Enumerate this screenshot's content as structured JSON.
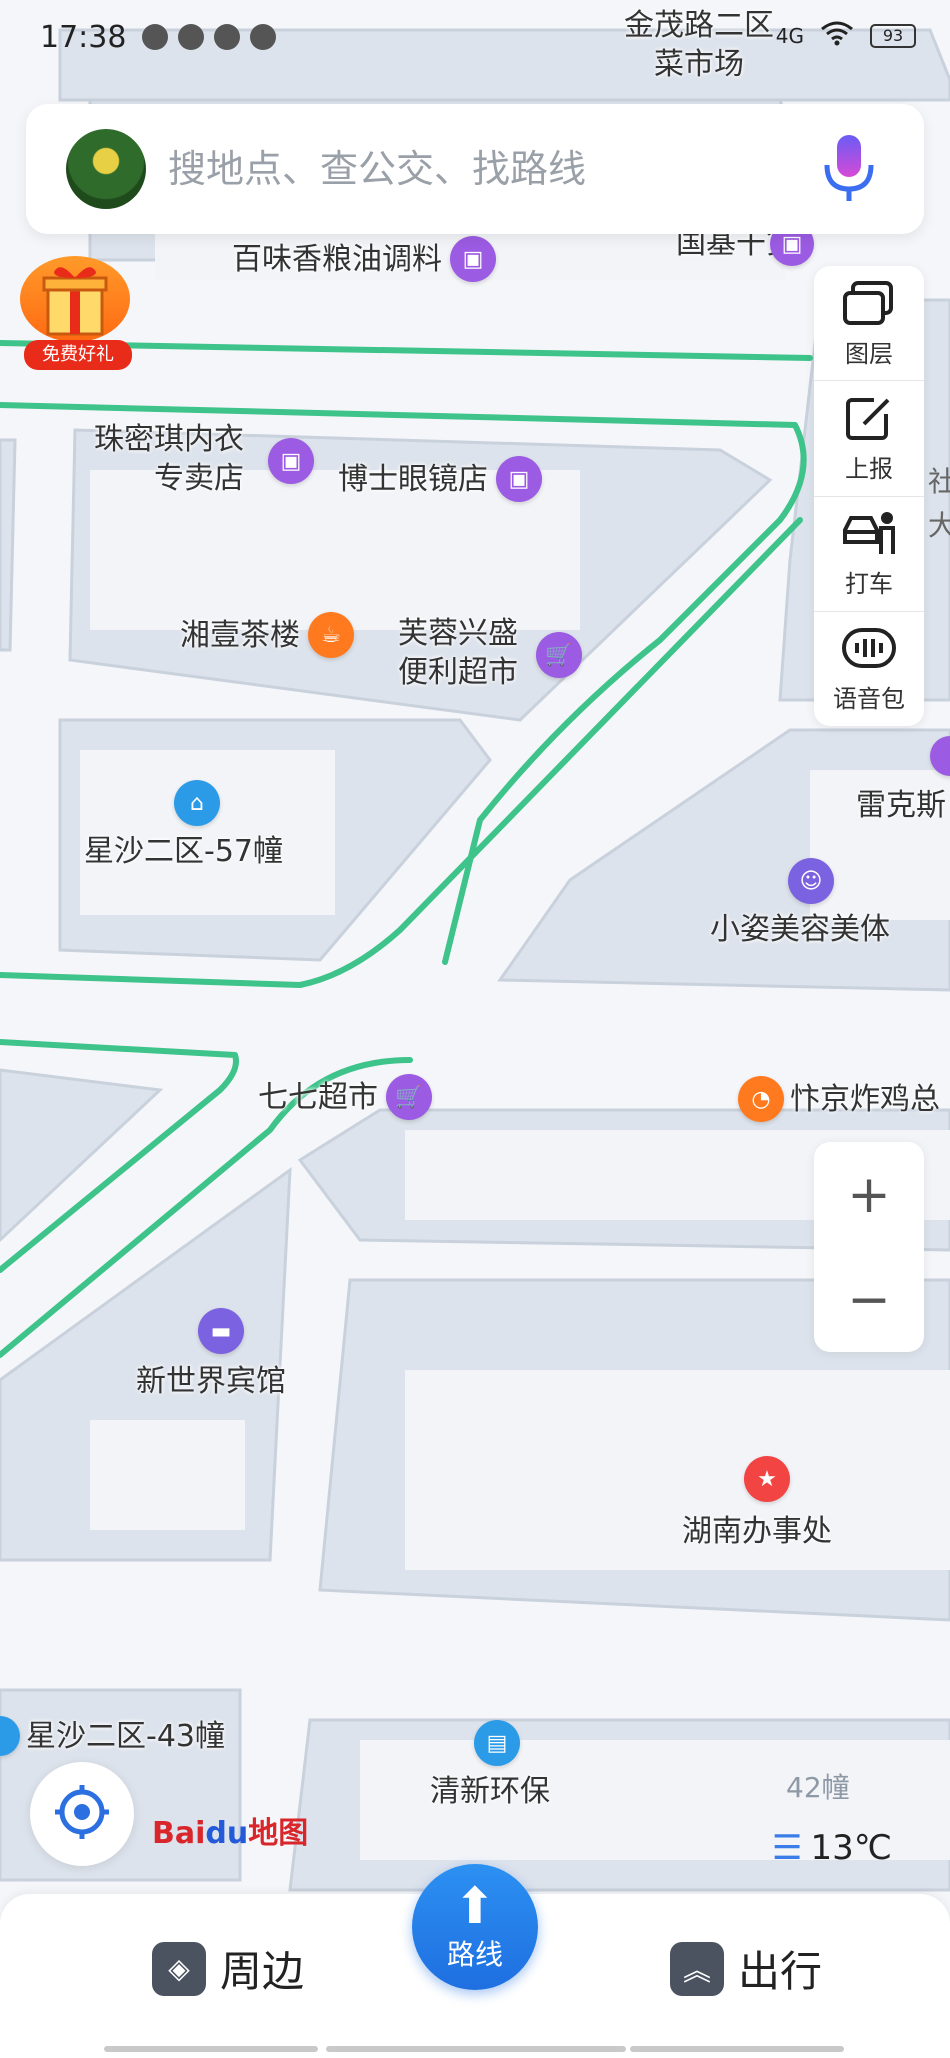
{
  "status_bar": {
    "time": "17:38",
    "battery": "93",
    "network": "4G"
  },
  "search": {
    "placeholder": "搜地点、查公交、找路线"
  },
  "gift": {
    "label": "免费好礼"
  },
  "tools": [
    {
      "label": "图层",
      "icon": "layers-icon"
    },
    {
      "label": "上报",
      "icon": "report-icon"
    },
    {
      "label": "打车",
      "icon": "taxi-icon"
    },
    {
      "label": "语音包",
      "icon": "voice-pack-icon"
    }
  ],
  "map": {
    "top_label_line1": "金茂路二区",
    "top_label_line2": "菜市场",
    "pois": [
      {
        "name": "百味香粮油调料",
        "type": "shop"
      },
      {
        "name": "国基干货",
        "type": "shop"
      },
      {
        "name_line1": "珠密琪内衣",
        "name_line2": "专卖店",
        "type": "shop"
      },
      {
        "name": "博士眼镜店",
        "type": "shop"
      },
      {
        "name": "湘壹茶楼",
        "type": "tea"
      },
      {
        "name_line1": "芙蓉兴盛",
        "name_line2": "便利超市",
        "type": "supermarket"
      },
      {
        "name": "星沙二区-57幢",
        "type": "residence"
      },
      {
        "name": "雷克斯",
        "type": "shop"
      },
      {
        "name": "小姿美容美体",
        "type": "beauty"
      },
      {
        "name": "七七超市",
        "type": "supermarket"
      },
      {
        "name": "忭京炸鸡总",
        "type": "food"
      },
      {
        "name": "新世界宾馆",
        "type": "hotel"
      },
      {
        "name": "湖南办事处",
        "type": "office"
      },
      {
        "name": "星沙二区-43幢",
        "type": "residence"
      },
      {
        "name": "清新环保",
        "type": "company"
      },
      {
        "name": "42幢",
        "type": "building"
      },
      {
        "name": "社",
        "type": "partial"
      },
      {
        "name": "大",
        "type": "partial"
      }
    ]
  },
  "logo": {
    "text1": "Bai",
    "text2": "du",
    "text3": "地图"
  },
  "weather": {
    "temp": "13℃"
  },
  "bottom_nav": {
    "nearby": "周边",
    "route": "路线",
    "travel": "出行"
  },
  "colors": {
    "accent": "#1f6fe0",
    "road_green": "#3ec38a",
    "poi_purple": "#9c5be3"
  }
}
